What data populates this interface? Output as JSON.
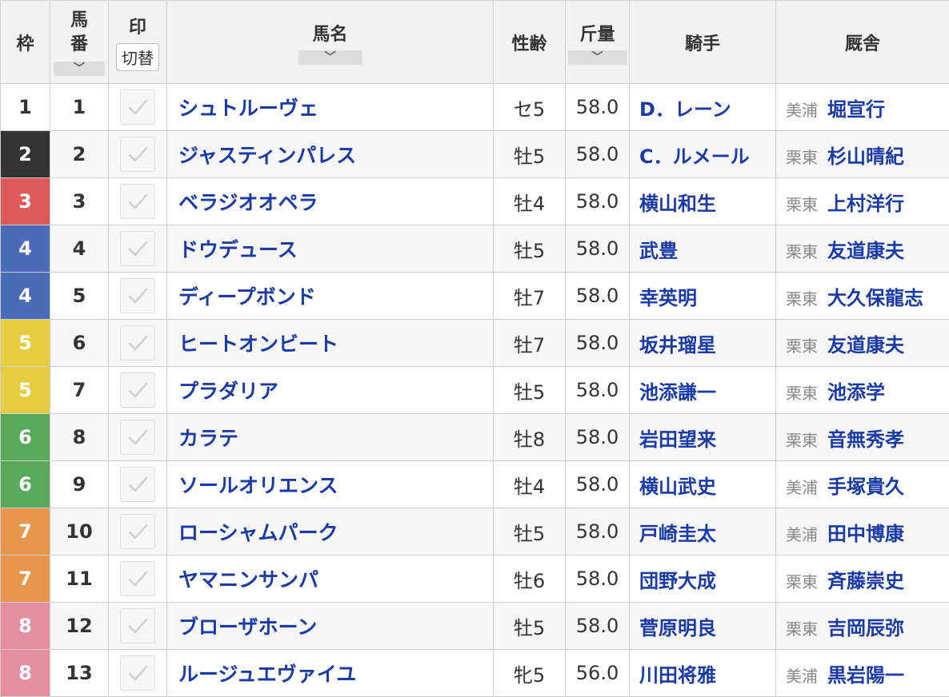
{
  "header": {
    "waku": "枠",
    "umaban_line1": "馬",
    "umaban_line2": "番",
    "mark": "印",
    "mark_toggle": "切替",
    "horse_name": "馬名",
    "sex_age": "性齢",
    "weight": "斤量",
    "jockey": "騎手",
    "stable": "厩舎",
    "sort_glyph": "﹀"
  },
  "waku_colors": {
    "1": {
      "bg": "#ffffff",
      "fg": "#333333"
    },
    "2": {
      "bg": "#333333",
      "fg": "#ffffff"
    },
    "3": {
      "bg": "#dc5a5a",
      "fg": "#ffffff"
    },
    "4": {
      "bg": "#4a6cb8",
      "fg": "#ffffff"
    },
    "5": {
      "bg": "#e6cc3e",
      "fg": "#ffffff"
    },
    "6": {
      "bg": "#5aa95a",
      "fg": "#ffffff"
    },
    "7": {
      "bg": "#e8964c",
      "fg": "#ffffff"
    },
    "8": {
      "bg": "#e58ea0",
      "fg": "#ffffff"
    }
  },
  "rows": [
    {
      "waku": "1",
      "num": "1",
      "name": "シュトルーヴェ",
      "sex_age": "セ5",
      "weight": "58.0",
      "jockey": "D．レーン",
      "region": "美浦",
      "trainer": "堀宣行"
    },
    {
      "waku": "2",
      "num": "2",
      "name": "ジャスティンパレス",
      "sex_age": "牡5",
      "weight": "58.0",
      "jockey": "C．ルメール",
      "region": "栗東",
      "trainer": "杉山晴紀"
    },
    {
      "waku": "3",
      "num": "3",
      "name": "ベラジオオペラ",
      "sex_age": "牡4",
      "weight": "58.0",
      "jockey": "横山和生",
      "region": "栗東",
      "trainer": "上村洋行"
    },
    {
      "waku": "4",
      "num": "4",
      "name": "ドウデュース",
      "sex_age": "牡5",
      "weight": "58.0",
      "jockey": "武豊",
      "region": "栗東",
      "trainer": "友道康夫"
    },
    {
      "waku": "4",
      "num": "5",
      "name": "ディープボンド",
      "sex_age": "牡7",
      "weight": "58.0",
      "jockey": "幸英明",
      "region": "栗東",
      "trainer": "大久保龍志"
    },
    {
      "waku": "5",
      "num": "6",
      "name": "ヒートオンビート",
      "sex_age": "牡7",
      "weight": "58.0",
      "jockey": "坂井瑠星",
      "region": "栗東",
      "trainer": "友道康夫"
    },
    {
      "waku": "5",
      "num": "7",
      "name": "プラダリア",
      "sex_age": "牡5",
      "weight": "58.0",
      "jockey": "池添謙一",
      "region": "栗東",
      "trainer": "池添学"
    },
    {
      "waku": "6",
      "num": "8",
      "name": "カラテ",
      "sex_age": "牡8",
      "weight": "58.0",
      "jockey": "岩田望来",
      "region": "栗東",
      "trainer": "音無秀孝"
    },
    {
      "waku": "6",
      "num": "9",
      "name": "ソールオリエンス",
      "sex_age": "牡4",
      "weight": "58.0",
      "jockey": "横山武史",
      "region": "美浦",
      "trainer": "手塚貴久"
    },
    {
      "waku": "7",
      "num": "10",
      "name": "ローシャムパーク",
      "sex_age": "牡5",
      "weight": "58.0",
      "jockey": "戸崎圭太",
      "region": "美浦",
      "trainer": "田中博康"
    },
    {
      "waku": "7",
      "num": "11",
      "name": "ヤマニンサンパ",
      "sex_age": "牡6",
      "weight": "58.0",
      "jockey": "団野大成",
      "region": "栗東",
      "trainer": "斉藤崇史"
    },
    {
      "waku": "8",
      "num": "12",
      "name": "ブローザホーン",
      "sex_age": "牡5",
      "weight": "58.0",
      "jockey": "菅原明良",
      "region": "栗東",
      "trainer": "吉岡辰弥"
    },
    {
      "waku": "8",
      "num": "13",
      "name": "ルージュエヴァイユ",
      "sex_age": "牝5",
      "weight": "56.0",
      "jockey": "川田将雅",
      "region": "美浦",
      "trainer": "黒岩陽一"
    }
  ]
}
